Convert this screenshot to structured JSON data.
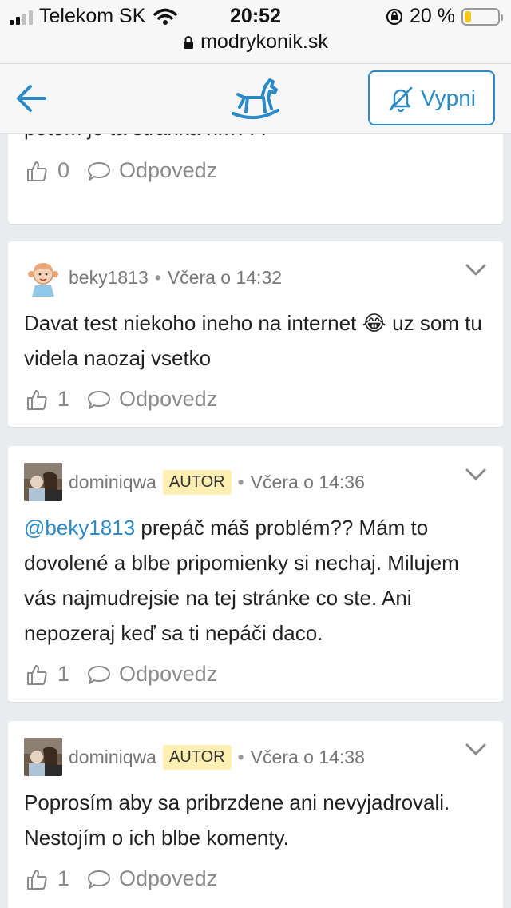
{
  "status_bar": {
    "carrier": "Telekom SK",
    "time": "20:52",
    "battery": "20 %",
    "battery_level": 0.2,
    "url": "modrykonik.sk"
  },
  "navbar": {
    "mute_label": "Vypni",
    "accent_color": "#2a8bc7"
  },
  "comments": [
    {
      "text": "potom je ta stránka hm???",
      "likes": "0",
      "reply_label": "Odpovedz"
    },
    {
      "author": "beky1813",
      "time": "Včera o 14:32",
      "text_before": "Davat test niekoho ineho na internet",
      "emoji": "😂",
      "text_after": "uz som tu videla naozaj vsetko",
      "likes": "1",
      "reply_label": "Odpovedz"
    },
    {
      "author": "dominiqwa",
      "badge": "AUTOR",
      "time": "Včera o 14:36",
      "mention": "@beky1813",
      "text": "prepáč máš problém?? Mám to dovolené a blbe pripomienky si nechaj. Milujem vás najmudrejsie na tej stránke co ste. Ani nepozeraj keď sa ti nepáči daco.",
      "likes": "1",
      "reply_label": "Odpovedz"
    },
    {
      "author": "dominiqwa",
      "badge": "AUTOR",
      "time": "Včera o 14:38",
      "text": "Poprosím aby sa pribrzdene ani nevyjadrovali. Nestojím o ich blbe komenty.",
      "likes": "1",
      "reply_label": "Odpovedz"
    }
  ]
}
